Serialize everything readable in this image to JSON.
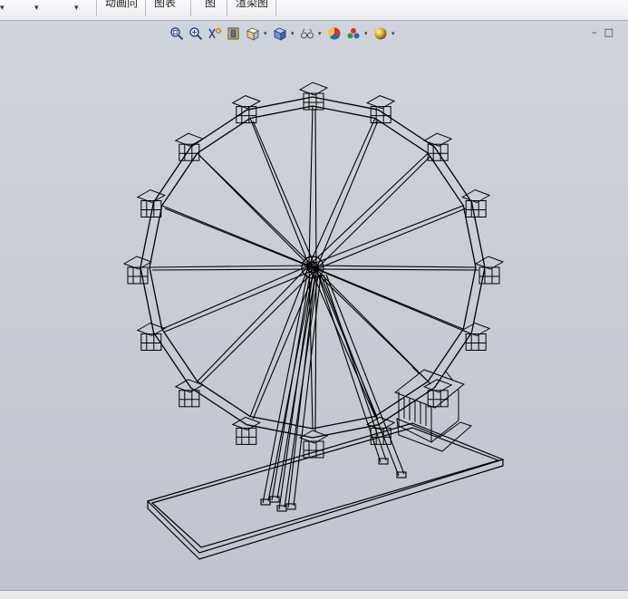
{
  "toolbar": {
    "labels": [
      "动画向",
      "图表",
      "图",
      "渲染图"
    ]
  },
  "view_toolbar": {
    "icons": [
      "zoom-to-fit-icon",
      "zoom-area-icon",
      "previous-view-icon",
      "section-view-icon",
      "view-orientation-icon",
      "display-style-icon",
      "hide-show-items-icon",
      "edit-appearance-icon",
      "apply-scene-icon",
      "view-settings-icon"
    ]
  },
  "window_controls": {
    "minimize": "–",
    "restore": "□"
  },
  "model": {
    "gondola_count": 16,
    "spoke_count": 16,
    "support_legs": 6
  },
  "colors": {
    "viewport_bg": "#c4c8d2",
    "wireframe": "#000000",
    "toolbar_bg": "#f2f3f6"
  }
}
